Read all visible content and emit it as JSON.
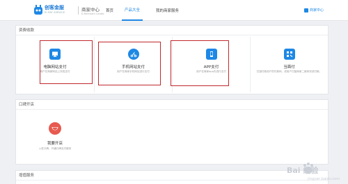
{
  "header": {
    "brand_name": "创客金服",
    "brand_sub": "EI-PAY SERVICE",
    "center_title": "商家中心",
    "center_sub": "E-Merchant Center",
    "nav": [
      {
        "label": "首页"
      },
      {
        "label": "产品大全"
      },
      {
        "label": "我的商家服务"
      }
    ],
    "user_center": "商家中心"
  },
  "sections": [
    {
      "title": "资费收款",
      "cards": [
        {
          "title": "电脑网站支付",
          "desc": "用户在商家网站上完成支付",
          "icon": "monitor-icon",
          "color": "#1e88e5"
        },
        {
          "title": "手机网站支付",
          "desc": "用户在商家手机网站进行支付",
          "icon": "scooter-icon",
          "color": "#1e88e5"
        },
        {
          "title": "APP支付",
          "desc": "用户在商家app内进行支付",
          "icon": "phone-icon",
          "color": "#1e88e5"
        },
        {
          "title": "当面付",
          "desc": "扫描付款用户的付款码，或用户扫描商家二维码完成付款。",
          "icon": "qr-icon",
          "color": "#1e88e5"
        }
      ]
    },
    {
      "title": "口碑开店",
      "cards": [
        {
          "title": "我要开店",
          "desc": "入驻口碑，开通口碑支付服务",
          "icon": "watermelon-icon",
          "color": "#e85a4f"
        }
      ]
    },
    {
      "title": "增值服务"
    }
  ],
  "watermark": {
    "text": "Bai 经验",
    "sub": "jingyan.baidu.com"
  }
}
